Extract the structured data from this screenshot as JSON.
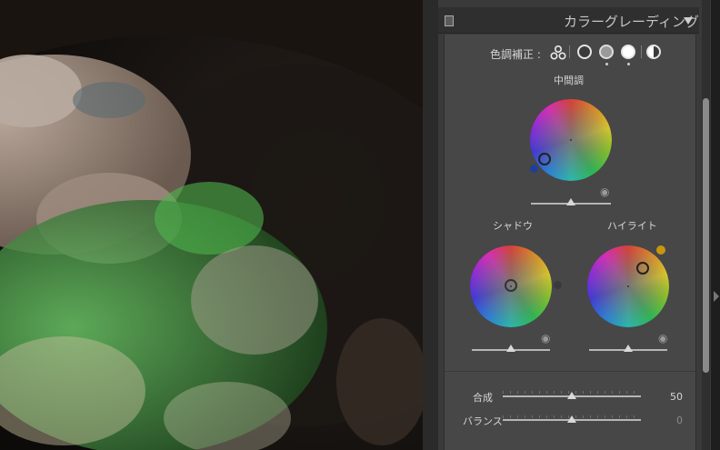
{
  "photo": {
    "description_icon": "image-preview"
  },
  "panel": {
    "title": "カラーグレーディング",
    "tone_label": "色調補正 :",
    "midtone_label": "中間調",
    "shadow_label": "シャドウ",
    "highlight_label": "ハイライト",
    "blend_label": "合成",
    "blend_value": "50",
    "balance_label": "バランス",
    "balance_value": "0"
  },
  "colors": {
    "panel_bg": "#474747",
    "header_bg": "#2f2f2f",
    "text": "#d6d6d6"
  },
  "sliders": {
    "midtone_luminance": 0.5,
    "shadow_luminance": 0.5,
    "highlight_luminance": 0.5,
    "blend": 0.5,
    "balance": 0.5
  }
}
